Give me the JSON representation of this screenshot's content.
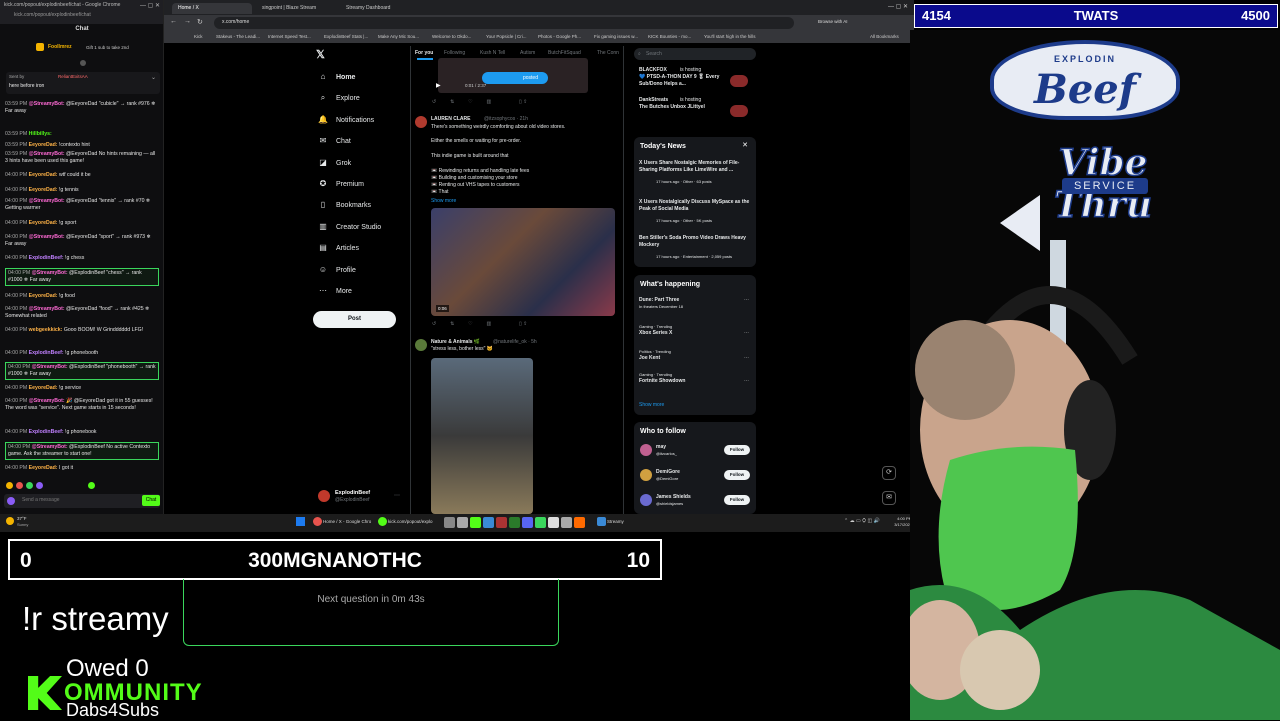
{
  "chat_window": {
    "title": "kick.com/popout/explodinbeef/chat - Google Chrome",
    "url": "kick.com/popout/explodinbeef/chat",
    "header": "Chat",
    "pinned_user": "FoolImrez",
    "pinned_text": "Gift 1 sub to take 2nd",
    "sent_by": "Sent by",
    "sent_by_user": "ReliantExitsAA",
    "pinned_note": "here before iron",
    "input_placeholder": "Send a message",
    "send_label": "Chat",
    "messages": [
      {
        "time": "03:59 PM",
        "user": "@StreamyBot:",
        "text": "@EeyoreDad \"cubicle\" → rank #976 ❄ Far away",
        "color": "#ff6ad5",
        "hl": false
      },
      {
        "time": "03:59 PM",
        "user": "Hillbillys:",
        "text": "",
        "color": "#53fc18",
        "hl": false
      },
      {
        "time": "03:59 PM",
        "user": "EeyoreDad:",
        "text": "!contexto hint",
        "color": "#ffb347",
        "hl": false
      },
      {
        "time": "03:59 PM",
        "user": "@StreamyBot:",
        "text": "@EeyoreDad No hints remaining — all 3 hints have been used this game!",
        "color": "#ff6ad5",
        "hl": false
      },
      {
        "time": "04:00 PM",
        "user": "EeyoreDad:",
        "text": "wtf could it be",
        "color": "#ffb347",
        "hl": false
      },
      {
        "time": "04:00 PM",
        "user": "EeyoreDad:",
        "text": "!g tennis",
        "color": "#ffb347",
        "hl": false
      },
      {
        "time": "04:00 PM",
        "user": "@StreamyBot:",
        "text": "@EeyoreDad \"tennis\" → rank #70 ❄ Getting warmer",
        "color": "#ff6ad5",
        "hl": false
      },
      {
        "time": "04:00 PM",
        "user": "EeyoreDad:",
        "text": "!g sport",
        "color": "#ffb347",
        "hl": false
      },
      {
        "time": "04:00 PM",
        "user": "@StreamyBot:",
        "text": "@EeyoreDad \"sport\" → rank #973 ❄ Far away",
        "color": "#ff6ad5",
        "hl": false
      },
      {
        "time": "04:00 PM",
        "user": "ExplodinBeef:",
        "text": "!g chess",
        "color": "#c080ff",
        "hl": false
      },
      {
        "time": "04:00 PM",
        "user": "@StreamyBot:",
        "text": "@ExplodinBeef \"chess\" → rank #1000 ❄ Far away",
        "color": "#ff6ad5",
        "hl": true
      },
      {
        "time": "04:00 PM",
        "user": "EeyoreDad:",
        "text": "!g food",
        "color": "#ffb347",
        "hl": false
      },
      {
        "time": "04:00 PM",
        "user": "@StreamyBot:",
        "text": "@EeyoreDad \"food\" → rank #425 ❄ Somewhat related",
        "color": "#ff6ad5",
        "hl": false
      },
      {
        "time": "04:00 PM",
        "user": "webgeekkick:",
        "text": "Gooo BOOM! W Grindddddd LFG!",
        "color": "#ffb347",
        "hl": false
      },
      {
        "time": "04:00 PM",
        "user": "ExplodinBeef:",
        "text": "!g phonebooth",
        "color": "#c080ff",
        "hl": false
      },
      {
        "time": "04:00 PM",
        "user": "@StreamyBot:",
        "text": "@ExplodinBeef \"phonebooth\" → rank #1000 ❄ Far away",
        "color": "#ff6ad5",
        "hl": true
      },
      {
        "time": "04:00 PM",
        "user": "EeyoreDad:",
        "text": "!g service",
        "color": "#ffb347",
        "hl": false
      },
      {
        "time": "04:00 PM",
        "user": "@StreamyBot:",
        "text": "🎉 @EeyoreDad got it in 55 guesses! The word was \"service\". Next game starts in 15 seconds!",
        "color": "#ff6ad5",
        "hl": false
      },
      {
        "time": "04:00 PM",
        "user": "ExplodinBeef:",
        "text": "!g phonebook",
        "color": "#c080ff",
        "hl": false
      },
      {
        "time": "04:00 PM",
        "user": "@StreamyBot:",
        "text": "@ExplodinBeef No active Contexto game. Ask the streamer to start one!",
        "color": "#ff6ad5",
        "hl": true
      },
      {
        "time": "04:00 PM",
        "user": "EeyoreDad:",
        "text": "I got it",
        "color": "#ffb347",
        "hl": false
      }
    ]
  },
  "browser": {
    "tabs": [
      "Home / X",
      "singpoint | Blaze Stream",
      "Streamy Dashboard"
    ],
    "url": "x.com/home",
    "translate_hint": "Browse with AI",
    "bookmarks": [
      "Kick",
      "Stakeus - The Leadi...",
      "Internet Speed Test...",
      "ExplodinBeef Stats |...",
      "Make Any Mic Sou...",
      "Welcome to Okdo...",
      "Your Popsicle | Cri...",
      "Photos - Google Ph...",
      "Fix gaming issues w...",
      "KICK Bounties - mo...",
      "You'll start high in the hills",
      "All Bookmarks"
    ]
  },
  "x_nav": {
    "items": [
      {
        "label": "Home",
        "icon": "⌂"
      },
      {
        "label": "Explore",
        "icon": "⌕"
      },
      {
        "label": "Notifications",
        "icon": "🔔"
      },
      {
        "label": "Chat",
        "icon": "✉"
      },
      {
        "label": "Grok",
        "icon": "◪"
      },
      {
        "label": "Premium",
        "icon": "✪"
      },
      {
        "label": "Bookmarks",
        "icon": "▯"
      },
      {
        "label": "Creator Studio",
        "icon": "▥"
      },
      {
        "label": "Articles",
        "icon": "▤"
      },
      {
        "label": "Profile",
        "icon": "☺"
      },
      {
        "label": "More",
        "icon": "⋯"
      }
    ],
    "post_label": "Post",
    "account_name": "ExplodinBeef",
    "account_handle": "@ExplodinBeef"
  },
  "feed": {
    "tabs": [
      "For you",
      "Following",
      "Kush N Tell",
      "Autism",
      "ButchFitSquad",
      "The Conn"
    ],
    "video_time": "0:01 / 2:37",
    "posted_badge": "posted",
    "tweet1": {
      "author": "LAUREN CLARE",
      "handle": "@itzsophycos · 21h",
      "line1": "There's something weirdly comforting about old video stores.",
      "line2": "Either the smells or waiting for pre-order.",
      "line3": "This indie game is built around that",
      "bullets": [
        "📼 Rewinding returns and handling late fees",
        "📼 Building and customising your store",
        "📼 Renting out VHS tapes to customers",
        "📼 That"
      ],
      "show_more": "Show more",
      "duration": "0:06"
    },
    "tweet2": {
      "author": "Nature & Animals 🌿",
      "handle": "@naturelife_ok · 5h",
      "text": "\"stress less, bother less\" 🐱"
    }
  },
  "right_col": {
    "search_placeholder": "Search",
    "spaces": [
      {
        "title": "BLACKFOX",
        "sub": "is hosting",
        "text": "💙 PTSD-A-THON DAY 9 🎖 Every Sub/Dono Helps a..."
      },
      {
        "title": "DankStreats",
        "sub": "is hosting",
        "text": "The Butches Unbox JLittyel"
      }
    ],
    "news_title": "Today's News",
    "news": [
      {
        "headline": "X Users Share Nostalgic Memories of File-Sharing Platforms Like LimeWire and ...",
        "meta": "17 hours ago · Other · 63 posts"
      },
      {
        "headline": "X Users Nostalgically Discuss MySpace as the Peak of Social Media",
        "meta": "17 hours ago · Other · 5K posts"
      },
      {
        "headline": "Ben Stiller's Soda Promo Video Draws Heavy Mockery",
        "meta": "17 hours ago · Entertainment · 2,059 posts"
      }
    ],
    "happening_title": "What's happening",
    "trends": [
      {
        "cat": "",
        "name": "Dune: Part Three",
        "meta": "In theaters December 18"
      },
      {
        "cat": "Gaming · Trending",
        "name": "Xbox Series X",
        "meta": ""
      },
      {
        "cat": "Politics · Trending",
        "name": "Joe Kent",
        "meta": ""
      },
      {
        "cat": "Gaming · Trending",
        "name": "Fortnite Showdown",
        "meta": ""
      }
    ],
    "show_more": "Show more",
    "follow_title": "Who to follow",
    "follows": [
      {
        "name": "may",
        "handle": "@itzcarlos_"
      },
      {
        "name": "DemiGore",
        "handle": "@DemiGore"
      },
      {
        "name": "James Shields",
        "handle": "@shieldsjames"
      }
    ],
    "follow_label": "Follow"
  },
  "taskbar": {
    "weather": "37°F",
    "weather_sub": "Sunny",
    "search": "Home / X - Google Chro",
    "window2": "kick.com/popout/explo",
    "window3": "Streamy",
    "time": "4:00 PM",
    "date": "3/17/2026"
  },
  "scoreboard_top": {
    "left": "4154",
    "title": "TWATS",
    "right": "4500"
  },
  "scoreboard_bottom": {
    "left": "0",
    "title": "300MGNANOTHC",
    "right": "10"
  },
  "next_question": "Next question in 0m 43s",
  "command": "!r streamy",
  "owed": "Owed 0",
  "community": "OMMUNITY",
  "dabs": "Dabs4Subs",
  "logo": {
    "top": "EXPLODIN",
    "middle": "Beef",
    "main": "Vibe Thru",
    "service": "SERVICE"
  },
  "colors": {
    "kick_green": "#53fc18",
    "score_blue": "#0a0a8c",
    "x_blue": "#1d9bf0",
    "hl_green": "#3ad65c"
  }
}
